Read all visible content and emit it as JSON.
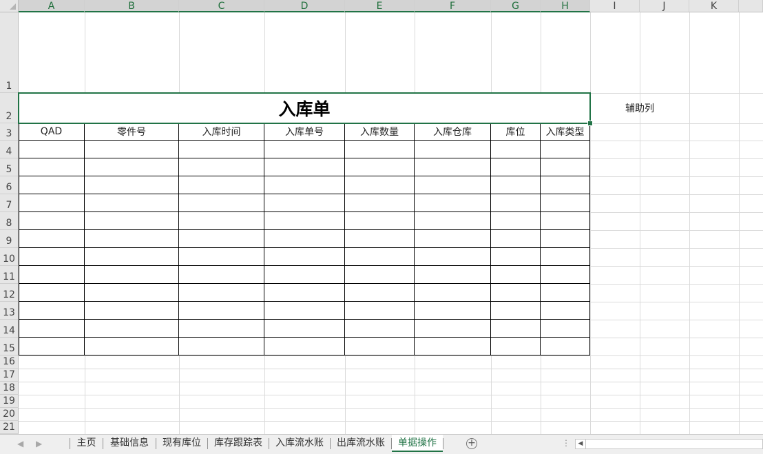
{
  "columns": [
    "A",
    "B",
    "C",
    "D",
    "E",
    "F",
    "G",
    "H",
    "I",
    "J",
    "K",
    ""
  ],
  "rows": [
    "1",
    "2",
    "3",
    "4",
    "5",
    "6",
    "7",
    "8",
    "9",
    "10",
    "11",
    "12",
    "13",
    "14",
    "15",
    "16",
    "17",
    "18",
    "19",
    "20",
    "21"
  ],
  "form": {
    "title": "入库单",
    "aux_label": "辅助列",
    "headers": [
      "QAD",
      "零件号",
      "入库时间",
      "入库单号",
      "入库数量",
      "入库仓库",
      "库位",
      "入库类型"
    ],
    "data_rows": 12
  },
  "tabs": {
    "items": [
      "主页",
      "基础信息",
      "现有库位",
      "库存跟踪表",
      "入库流水账",
      "出库流水账",
      "单据操作"
    ],
    "active_index": 6,
    "add_icon": "plus-circle-icon",
    "prev_icon": "chevron-left-icon",
    "next_icon": "chevron-right-icon",
    "more_icon": "vertical-dots-icon"
  },
  "colors": {
    "accent": "#217346",
    "header_bg": "#e6e6e6",
    "grid": "#dadada"
  }
}
